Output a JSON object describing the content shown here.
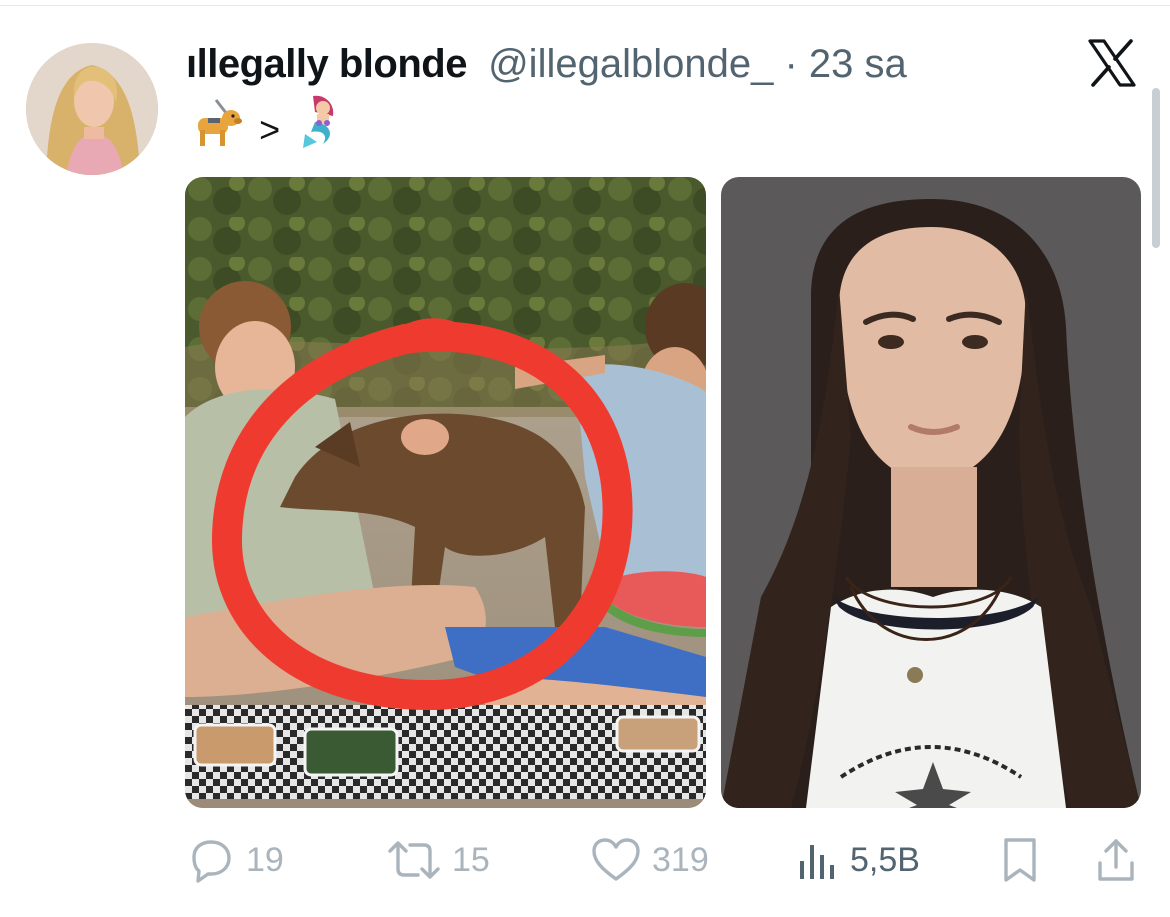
{
  "tweet": {
    "author": {
      "display_name": "ıllegally blonde",
      "handle": "@illegalblonde_",
      "separator": "·",
      "timestamp": "23 sa",
      "avatar_icon": "profile-photo"
    },
    "text": {
      "emoji_1_icon": "guide-dog-emoji",
      "operator": ">",
      "emoji_2_icon": "mermaid-emoji"
    },
    "media": [
      {
        "icon": "photo-picnic-dog-circled"
      },
      {
        "icon": "photo-portrait-woman"
      }
    ],
    "actions": {
      "replies": "19",
      "retweets": "15",
      "likes": "319",
      "views": "5,5B"
    }
  },
  "app": {
    "logo_icon": "x-logo-icon"
  },
  "colors": {
    "text_primary": "#0f1419",
    "text_secondary": "#536471",
    "action_faded": "#aab4bd",
    "circle_annotation": "#ef3b2f"
  }
}
